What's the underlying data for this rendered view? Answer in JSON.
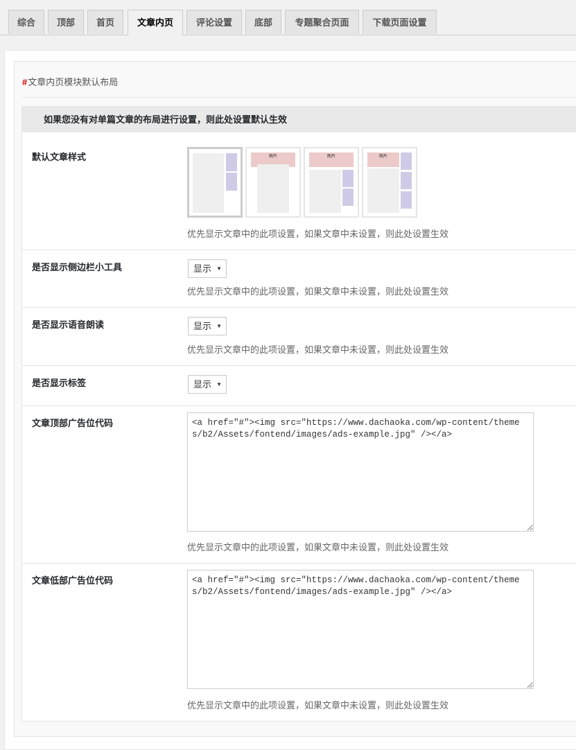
{
  "tabs": [
    {
      "label": "综合"
    },
    {
      "label": "顶部"
    },
    {
      "label": "首页"
    },
    {
      "label": "文章内页"
    },
    {
      "label": "评论设置"
    },
    {
      "label": "底部"
    },
    {
      "label": "专题聚合页面"
    },
    {
      "label": "下载页面设置"
    }
  ],
  "active_tab": "文章内页",
  "section": {
    "hash": "#",
    "title": "文章内页模块默认布局"
  },
  "notice": "如果您没有对单篇文章的布局进行设置，则此处设置默认生效",
  "fields": {
    "style": {
      "label": "默认文章样式",
      "img_label": "图片",
      "desc": "优先显示文章中的此项设置，如果文章中未设置，则此处设置生效"
    },
    "sidebar": {
      "label": "是否显示侧边栏小工具",
      "value": "显示",
      "desc": "优先显示文章中的此项设置，如果文章中未设置，则此处设置生效"
    },
    "voice": {
      "label": "是否显示语音朗读",
      "value": "显示",
      "desc": "优先显示文章中的此项设置，如果文章中未设置，则此处设置生效"
    },
    "tags": {
      "label": "是否显示标签",
      "value": "显示"
    },
    "top_ad": {
      "label": "文章顶部广告位代码",
      "value": "<a href=\"#\"><img src=\"https://www.dachaoka.com/wp-content/themes/b2/Assets/fontend/images/ads-example.jpg\" /></a>",
      "desc": "优先显示文章中的此项设置，如果文章中未设置，则此处设置生效"
    },
    "bottom_ad": {
      "label": "文章低部广告位代码",
      "value": "<a href=\"#\"><img src=\"https://www.dachaoka.com/wp-content/themes/b2/Assets/fontend/images/ads-example.jpg\" /></a>",
      "desc": "优先显示文章中的此项设置，如果文章中未设置，则此处设置生效"
    }
  },
  "colors": {
    "hash": "#dd0000",
    "sidebar_block": "#cfcbe6",
    "image_block": "#eccaca",
    "main_block": "#efefef"
  }
}
